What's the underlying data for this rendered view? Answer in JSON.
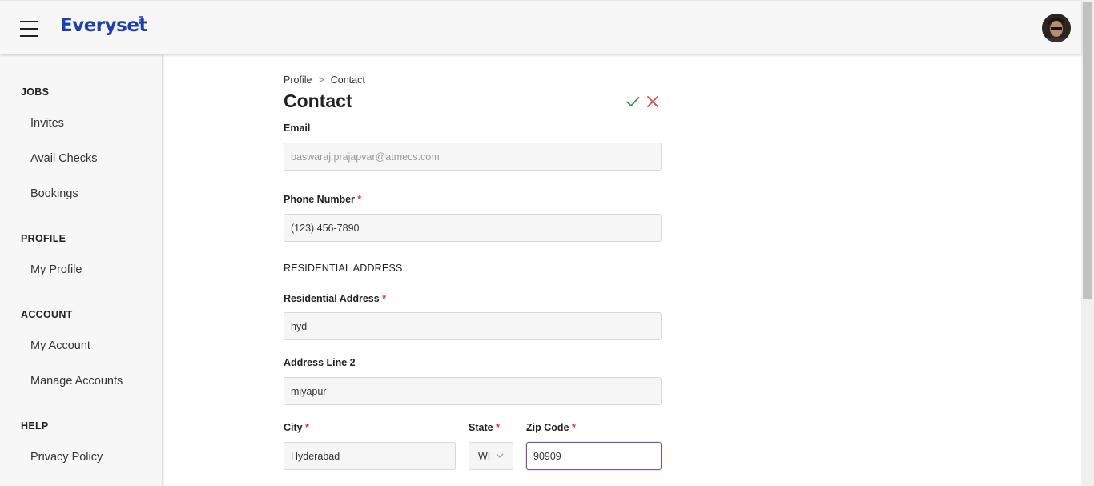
{
  "header": {
    "brand": "Everyset",
    "menu_icon": "hamburger-icon",
    "avatar_icon": "user-avatar"
  },
  "sidebar": {
    "sections": [
      {
        "heading": "JOBS",
        "items": [
          "Invites",
          "Avail Checks",
          "Bookings"
        ]
      },
      {
        "heading": "PROFILE",
        "items": [
          "My Profile"
        ]
      },
      {
        "heading": "ACCOUNT",
        "items": [
          "My Account",
          "Manage Accounts"
        ]
      },
      {
        "heading": "HELP",
        "items": [
          "Privacy Policy"
        ]
      }
    ]
  },
  "breadcrumb": {
    "parent": "Profile",
    "separator": ">",
    "current": "Contact"
  },
  "page": {
    "title": "Contact",
    "save_icon": "check-icon",
    "cancel_icon": "close-icon",
    "accent_save": "#2e9a4a",
    "accent_cancel": "#e04848"
  },
  "form": {
    "email": {
      "label": "Email",
      "value": "baswaraj.prajapvar@atmecs.com"
    },
    "phone": {
      "label": "Phone Number",
      "required": "*",
      "value": "(123) 456-7890"
    },
    "section_title": "RESIDENTIAL ADDRESS",
    "address": {
      "label": "Residential Address",
      "required": "*",
      "value": "hyd"
    },
    "address2": {
      "label": "Address Line 2",
      "value": "miyapur"
    },
    "city": {
      "label": "City",
      "required": "*",
      "value": "Hyderabad"
    },
    "state": {
      "label": "State",
      "required": "*",
      "value": "WI"
    },
    "zip": {
      "label": "Zip Code",
      "required": "*",
      "value": "90909"
    }
  }
}
